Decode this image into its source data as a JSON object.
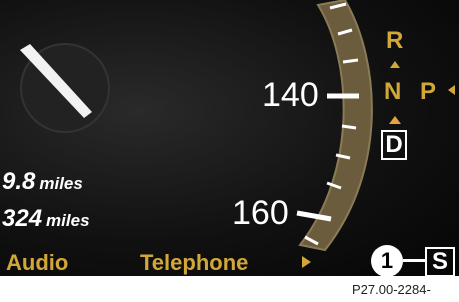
{
  "speedometer": {
    "label_140": "140",
    "label_160": "160"
  },
  "trip": {
    "trip_value": "9.8",
    "trip_unit": "miles",
    "total_value": "324",
    "total_unit": "miles"
  },
  "menu": {
    "audio_label": "Audio",
    "telephone_label": "Telephone"
  },
  "transmission": {
    "gear_r": "R",
    "gear_n": "N",
    "gear_p": "P",
    "gear_d": "D",
    "mode": "S"
  },
  "callout": {
    "number": "1"
  },
  "figure_id": "P27.00-2284-",
  "colors": {
    "accent": "#d1a73a",
    "arc": "#6a5a3c",
    "highlight_arrow": "#e6a33a"
  }
}
